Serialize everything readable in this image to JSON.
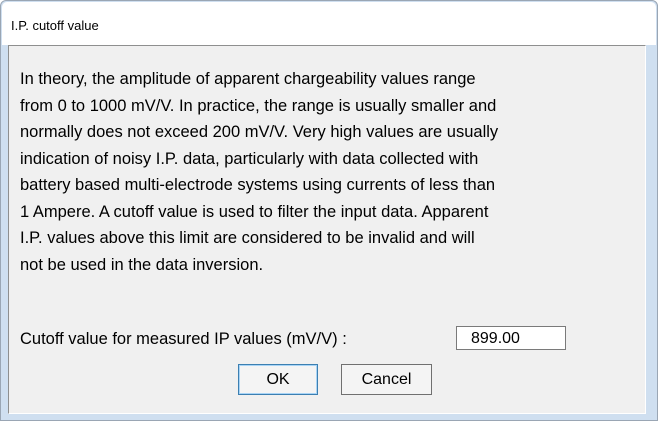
{
  "window": {
    "title": "I.P. cutoff value"
  },
  "dialog": {
    "description": "In theory, the amplitude of apparent chargeability values range\nfrom 0 to 1000 mV/V. In practice, the range is usually smaller and\nnormally does not exceed 200 mV/V. Very high values are usually\nindication of noisy I.P. data, particularly with data collected with\nbattery based multi-electrode systems using currents of less than\n1 Ampere. A cutoff value is used to filter the input data. Apparent\nI.P. values above this limit are considered to be invalid and will\nnot be used in the data inversion.",
    "cutoff_label": "Cutoff value for measured IP values (mV/V) :",
    "cutoff_value": "899.00",
    "ok_label": "OK",
    "cancel_label": "Cancel"
  }
}
